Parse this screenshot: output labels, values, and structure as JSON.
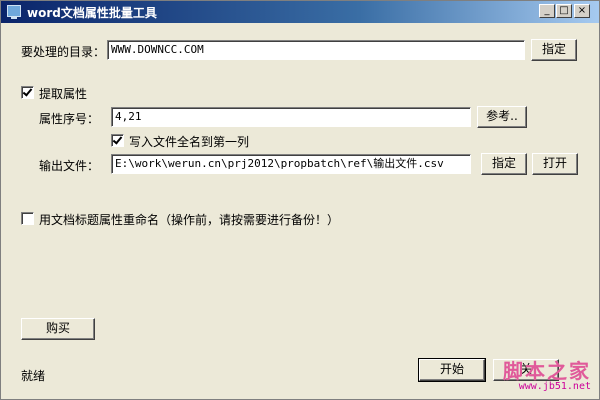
{
  "window": {
    "title": "word文档属性批量工具",
    "min_label": "_",
    "max_label": "□",
    "close_label": "×"
  },
  "directory": {
    "label": "要处理的目录：",
    "value": "WWW.DOWNCC.COM",
    "browse_label": "指定"
  },
  "extract": {
    "checkbox_label": "提取属性",
    "checked": true,
    "index_label": "属性序号：",
    "index_value": "4,21",
    "ref_button": "参考..",
    "write_name_label": "写入文件全名到第一列",
    "write_name_checked": true,
    "output_label": "输出文件：",
    "output_value": "E:\\work\\werun.cn\\prj2012\\propbatch\\ref\\输出文件.csv",
    "output_browse": "指定",
    "output_open": "打开"
  },
  "rename": {
    "checkbox_label": "用文档标题属性重命名（操作前，请按需要进行备份！）",
    "checked": false
  },
  "buy_button": "购买",
  "status": "就绪",
  "start_button": "开始",
  "close_button": "关",
  "watermark": {
    "main": "脚本之家",
    "sub": "www.jb51.net"
  }
}
